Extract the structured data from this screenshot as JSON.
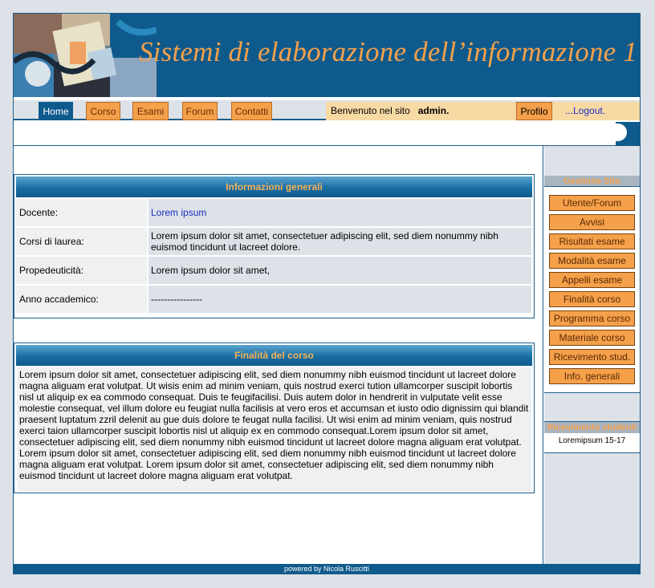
{
  "header": {
    "title": "Sistemi di elaborazione dell’informazione 1"
  },
  "nav": {
    "items": [
      "Home",
      "Corso",
      "Esami",
      "Forum",
      "Contatti"
    ],
    "welcome_text": "Benvenuto nel sito",
    "username": "admin.",
    "profile_label": "Profilo",
    "logout_label": "...Logout."
  },
  "info_panel": {
    "title": "Informazioni generali",
    "rows": [
      {
        "label": "Docente:",
        "value": "Lorem ipsum"
      },
      {
        "label": "Corsi di laurea:",
        "value": "Lorem ipsum dolor sit amet, consectetuer adipiscing elit, sed diem nonummy nibh euismod tincidunt ut lacreet dolore."
      },
      {
        "label": "Propedeuticità:",
        "value": "Lorem ipsum dolor sit amet,"
      },
      {
        "label": "Anno accademico:",
        "value": "----------------"
      }
    ]
  },
  "aims_panel": {
    "title": "Finalità del corso",
    "text": "Lorem ipsum dolor sit amet, consectetuer adipiscing elit, sed diem nonummy nibh euismod tincidunt ut lacreet dolore magna aliguam erat volutpat. Ut wisis enim ad minim veniam, quis nostrud exerci tution ullamcorper suscipit lobortis nisl ut aliquip ex ea commodo consequat. Duis te feugifacilisi. Duis autem dolor in hendrerit in vulputate velit esse molestie consequat, vel illum dolore eu feugiat nulla facilisis at vero eros et accumsan et iusto odio dignissim qui blandit praesent luptatum zzril delenit au gue duis dolore te feugat nulla facilisi. Ut wisi enim ad minim veniam, quis nostrud exerci taion ullamcorper suscipit lobortis nisl ut aliquip ex en commodo consequat.Lorem ipsum dolor sit amet, consectetuer adipiscing elit, sed diem nonummy nibh euismod tincidunt ut lacreet dolore magna aliguam erat volutpat. Lorem ipsum dolor sit amet, consectetuer adipiscing elit, sed diem nonummy nibh euismod tincidunt ut lacreet dolore magna aliguam erat volutpat. Lorem ipsum dolor sit amet, consectetuer adipiscing elit, sed diem nonummy nibh euismod tincidunt ut lacreet dolore magna aliguam erat volutpat."
  },
  "sidebar": {
    "admin_title": "Gestione Sito",
    "admin_buttons": [
      "Utente/Forum",
      "Avvisi",
      "Risultati esame",
      "Modalità esame",
      "Appelli esame",
      "Finalità corso",
      "Programma corso",
      "Materiale corso",
      "Ricevimento stud.",
      "Info. generali"
    ],
    "reception_title": "Ricevimento studenti",
    "reception_text": "Loremipsum 15-17"
  },
  "footer": {
    "text": "powered by Nicola Ruscitti"
  },
  "colors": {
    "brand_blue": "#0f5a8c",
    "accent_orange": "#f5a04a",
    "light_grey": "#dce2e8"
  }
}
